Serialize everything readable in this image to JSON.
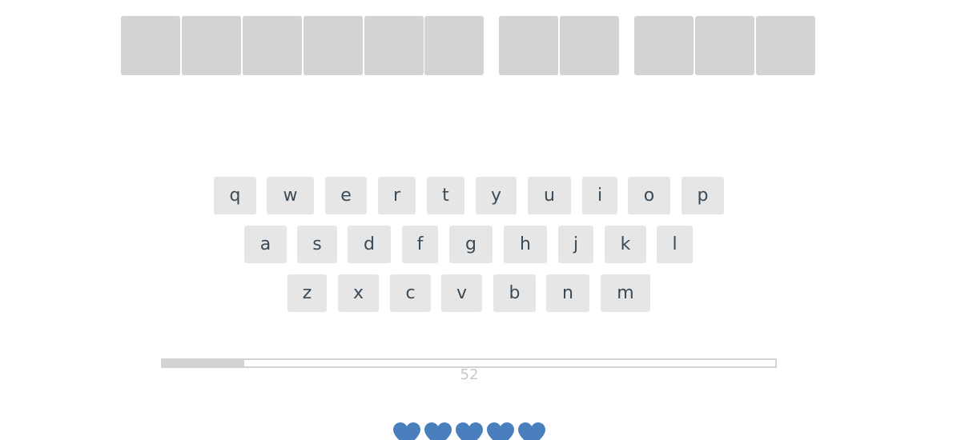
{
  "word": {
    "groups": [
      6,
      2,
      3
    ],
    "letters": [
      "",
      "",
      "",
      "",
      "",
      "",
      "",
      "",
      "",
      "",
      ""
    ]
  },
  "keyboard": {
    "rows": [
      [
        "q",
        "w",
        "e",
        "r",
        "t",
        "y",
        "u",
        "i",
        "o",
        "p"
      ],
      [
        "a",
        "s",
        "d",
        "f",
        "g",
        "h",
        "j",
        "k",
        "l"
      ],
      [
        "z",
        "x",
        "c",
        "v",
        "b",
        "n",
        "m"
      ]
    ]
  },
  "timer": {
    "value": "52",
    "progress": 0.133
  },
  "lives": {
    "count": 5,
    "icon": "heart-icon",
    "color": "#4a7fbd"
  },
  "colors": {
    "tile": "#d3d3d3",
    "key_bg": "#e6e6e6",
    "key_text": "#3a4a57",
    "timer_text": "#c8c8c8"
  }
}
